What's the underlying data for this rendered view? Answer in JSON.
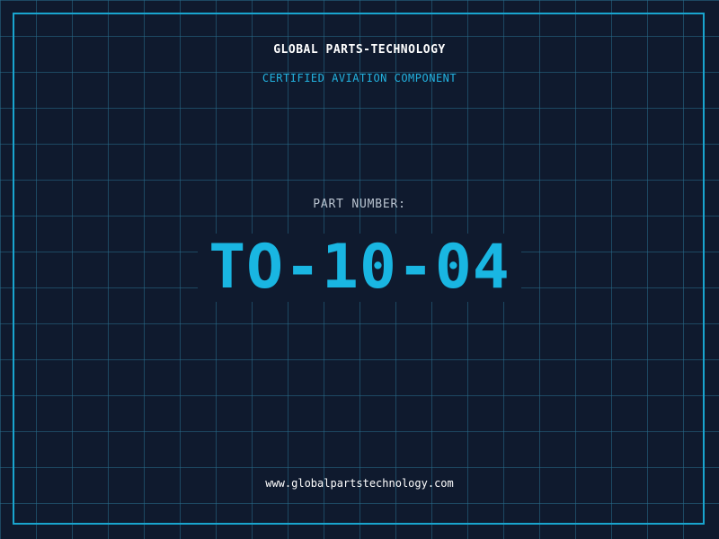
{
  "header": {
    "company_name": "GLOBAL PARTS-TECHNOLOGY",
    "tagline": "CERTIFIED AVIATION COMPONENT"
  },
  "part": {
    "label": "PART NUMBER:",
    "number": "TO-10-04"
  },
  "footer": {
    "website": "www.globalpartstechnology.com"
  },
  "colors": {
    "background": "#0f1a2e",
    "grid": "#286e8c",
    "frame": "#19a5cf",
    "accent": "#19b6e2",
    "label": "#b9c3cf",
    "text": "#ffffff"
  }
}
